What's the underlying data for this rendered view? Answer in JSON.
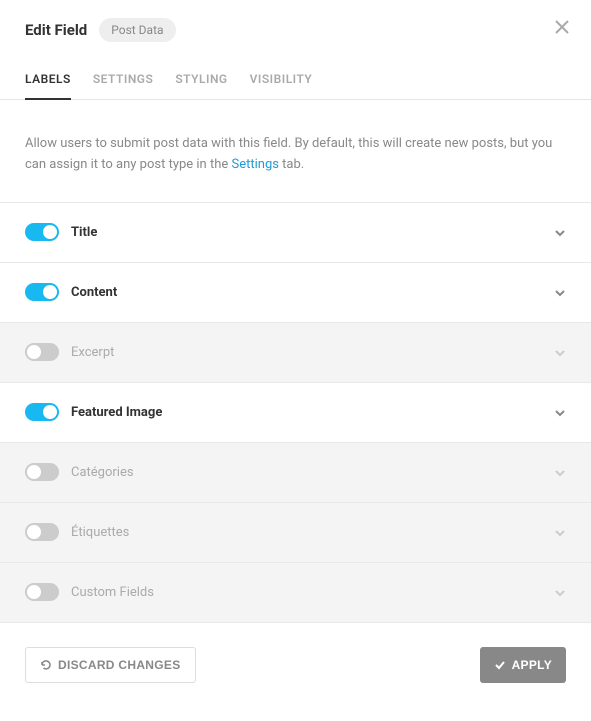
{
  "header": {
    "title": "Edit Field",
    "badge": "Post Data"
  },
  "tabs": [
    {
      "label": "LABELS",
      "active": true
    },
    {
      "label": "SETTINGS",
      "active": false
    },
    {
      "label": "STYLING",
      "active": false
    },
    {
      "label": "VISIBILITY",
      "active": false
    }
  ],
  "description": {
    "text_before": "Allow users to submit post data with this field. By default, this will create new posts, but you can assign it to any post type in the ",
    "link_text": "Settings",
    "text_after": " tab."
  },
  "fields": [
    {
      "label": "Title",
      "enabled": true
    },
    {
      "label": "Content",
      "enabled": true
    },
    {
      "label": "Excerpt",
      "enabled": false
    },
    {
      "label": "Featured Image",
      "enabled": true
    },
    {
      "label": "Catégories",
      "enabled": false
    },
    {
      "label": "Étiquettes",
      "enabled": false
    },
    {
      "label": "Custom Fields",
      "enabled": false
    }
  ],
  "footer": {
    "discard_label": "DISCARD CHANGES",
    "apply_label": "APPLY"
  }
}
